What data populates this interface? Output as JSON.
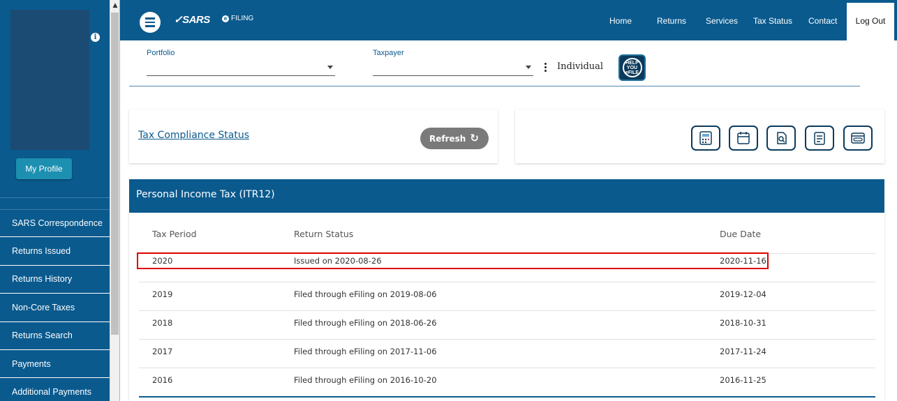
{
  "sidebar": {
    "info_glyph": "i",
    "my_profile_label": "My Profile",
    "items": [
      {
        "label": "SARS Correspondence"
      },
      {
        "label": "Returns Issued"
      },
      {
        "label": "Returns History"
      },
      {
        "label": "Non-Core Taxes"
      },
      {
        "label": "Returns Search"
      },
      {
        "label": "Payments"
      },
      {
        "label": "Additional Payments"
      }
    ]
  },
  "header": {
    "logo_text": "SARS",
    "efiling_text": "FILING",
    "efiling_badge": "e",
    "nav": {
      "home": "Home",
      "returns": "Returns",
      "services": "Services",
      "tax_status": "Tax Status",
      "contact": "Contact",
      "logout": "Log Out"
    }
  },
  "selectors": {
    "portfolio_label": "Portfolio",
    "portfolio_value": "",
    "taxpayer_label": "Taxpayer",
    "taxpayer_value": "",
    "taxpayer_type": "Individual",
    "help_line1": "HELP",
    "help_line2": "YOU",
    "help_line3": "eFILE"
  },
  "compliance": {
    "link_label": "Tax Compliance Status",
    "refresh_label": "Refresh"
  },
  "tool_icons": [
    "calculator-icon",
    "calendar-icon",
    "search-document-icon",
    "checklist-icon",
    "browser-form-icon"
  ],
  "itr12": {
    "title": "Personal Income Tax (ITR12)",
    "columns": {
      "period": "Tax Period",
      "status": "Return Status",
      "due": "Due Date"
    },
    "rows": [
      {
        "period": "2020",
        "status": "Issued on 2020-08-26",
        "due": "2020-11-16",
        "highlighted": true
      },
      {
        "period": "2019",
        "status": "Filed through eFiling on 2019-08-06",
        "due": "2019-12-04"
      },
      {
        "period": "2018",
        "status": "Filed through eFiling on 2018-06-26",
        "due": "2018-10-31"
      },
      {
        "period": "2017",
        "status": "Filed through eFiling on 2017-11-06",
        "due": "2017-11-24"
      },
      {
        "period": "2016",
        "status": "Filed through eFiling on 2016-10-20",
        "due": "2016-11-25"
      }
    ]
  },
  "colors": {
    "brand": "#0a5a8e",
    "highlight": "#e00000",
    "refresh": "#7a7a7a"
  }
}
